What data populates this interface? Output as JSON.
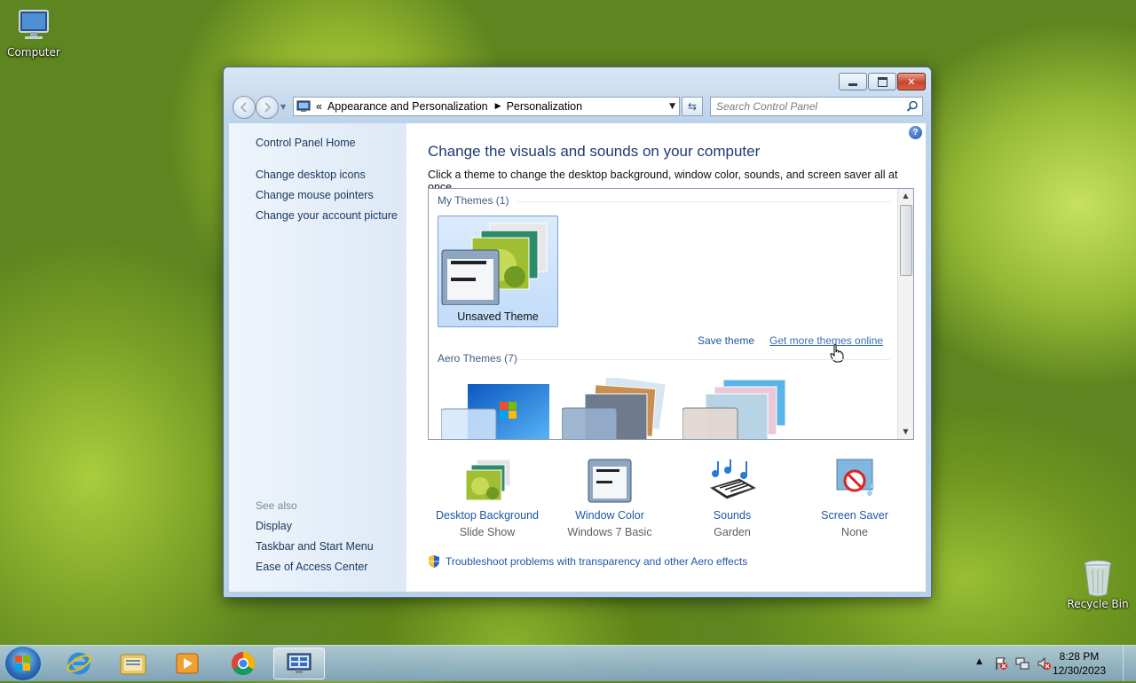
{
  "desktop": {
    "computer_label": "Computer",
    "recycle_label": "Recycle Bin"
  },
  "window": {
    "breadcrumb": {
      "overflow": "«",
      "items": [
        "Appearance and Personalization",
        "Personalization"
      ]
    },
    "search_placeholder": "Search Control Panel",
    "help_glyph": "?"
  },
  "left_pane": {
    "links": [
      "Control Panel Home",
      "Change desktop icons",
      "Change mouse pointers",
      "Change your account picture"
    ],
    "see_also_label": "See also",
    "see_also": [
      "Display",
      "Taskbar and Start Menu",
      "Ease of Access Center"
    ]
  },
  "main": {
    "title": "Change the visuals and sounds on your computer",
    "subtitle": "Click a theme to change the desktop background, window color, sounds, and screen saver all at once.",
    "my_themes_label": "My Themes (1)",
    "selected_theme": "Unsaved Theme",
    "save_theme": "Save theme",
    "get_more": "Get more themes online",
    "aero_label": "Aero Themes (7)",
    "settings": [
      {
        "label": "Desktop Background",
        "value": "Slide Show"
      },
      {
        "label": "Window Color",
        "value": "Windows 7 Basic"
      },
      {
        "label": "Sounds",
        "value": "Garden"
      },
      {
        "label": "Screen Saver",
        "value": "None"
      }
    ],
    "troubleshoot": "Troubleshoot problems with transparency and other Aero effects"
  },
  "taskbar": {
    "time": "8:28 PM",
    "date": "12/30/2023",
    "apps": [
      "internet-explorer",
      "windows-explorer",
      "media-player",
      "chrome",
      "control-panel"
    ]
  },
  "colors": {
    "link": "#1f57a3",
    "heading": "#1e3c73",
    "selection": "#c1dcfa"
  }
}
